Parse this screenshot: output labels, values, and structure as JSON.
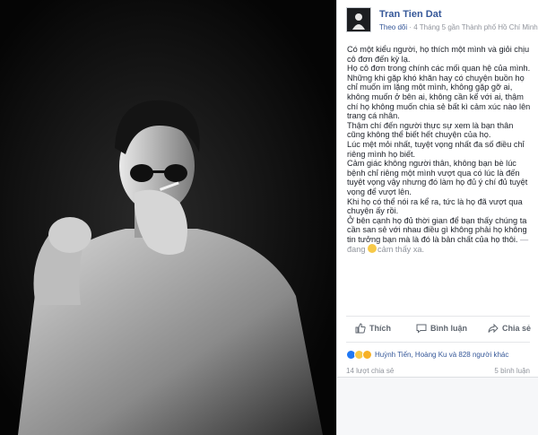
{
  "post": {
    "author": "Tran Tien Dat",
    "follow_label": "Theo dõi",
    "meta_text": " · 4 Tháng 5 gần Thành phố Hồ Chí Minh · ",
    "paragraphs": [
      "Có một kiểu người, họ thích một mình và giỏi chịu cô đơn đến kỳ lạ.",
      "Họ cô đơn trong chính các mối quan hệ của mình.",
      "Những khi gặp khó khăn hay có chuyện buồn họ chỉ muốn im lặng một mình, không gặp gỡ ai, không muốn ở bên ai, không cần kể với ai, thậm chí họ không muốn chia sẻ bất kì cảm xúc nào lên trang cá nhân.",
      "Thậm chí đến người thực sự xem là bạn thân cũng không thể biết hết chuyện của họ.",
      "Lúc mệt mỏi nhất, tuyệt vọng nhất đa số điều chỉ riêng mình họ biết.",
      "Cảm giác không người thân, không bạn bè lúc bệnh chỉ riêng một mình vượt qua có lúc là đến tuyệt vọng vậy nhưng đó làm họ đủ ý chí đủ tuyệt vọng để vượt lên.",
      "Khi họ có thể nói ra kể ra, tức là họ đã vượt qua chuyện ấy rồi.",
      "Ở bên cạnh họ đủ thời gian để bạn thấy chúng ta cần san sẻ với nhau điều gì không phải họ không tin tưởng bạn mà là đó là bản chất của họ thôi."
    ],
    "feeling_text": " — đang ",
    "feeling_value": "cảm thấy xa."
  },
  "actions": {
    "like_label": "Thích",
    "comment_label": "Bình luận",
    "share_label": "Chia sẻ"
  },
  "reactions": {
    "names": "Huỳnh Tiến, Hoàng Ku và 828 người khác"
  },
  "stats": {
    "shares": "14 lượt chia sẻ",
    "comments": "5 bình luận"
  },
  "colors": {
    "link": "#365899",
    "muted": "#90949c",
    "like_blue": "#2078f4"
  }
}
